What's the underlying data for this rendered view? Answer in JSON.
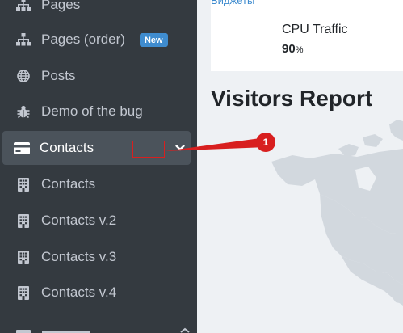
{
  "sidebar": {
    "items": [
      {
        "label": "Pages",
        "icon": "sitemap-icon"
      },
      {
        "label": "Pages (order)",
        "icon": "sitemap-icon",
        "badge": "New"
      },
      {
        "label": "Posts",
        "icon": "globe-icon"
      },
      {
        "label": "Demo of the bug",
        "icon": "bug-icon"
      },
      {
        "label": "Contacts",
        "icon": "credit-card-icon",
        "active": true
      },
      {
        "label": "Contacts",
        "icon": "building-icon"
      },
      {
        "label": "Contacts v.2",
        "icon": "building-icon"
      },
      {
        "label": "Contacts v.3",
        "icon": "building-icon"
      },
      {
        "label": "Contacts v.4",
        "icon": "building-icon"
      }
    ]
  },
  "widgets": {
    "header": "Виджеты",
    "title": "CPU Traffic",
    "value": "90",
    "unit": "%"
  },
  "report": {
    "title": "Visitors Report"
  },
  "annotation": {
    "step": "1",
    "color": "#d81f1f"
  },
  "colors": {
    "sidebar_bg": "#343a40",
    "active_bg": "#4b535b",
    "badge": "#3f8ccf",
    "content_bg": "#eef1f4",
    "map_land": "#d2d8de"
  }
}
